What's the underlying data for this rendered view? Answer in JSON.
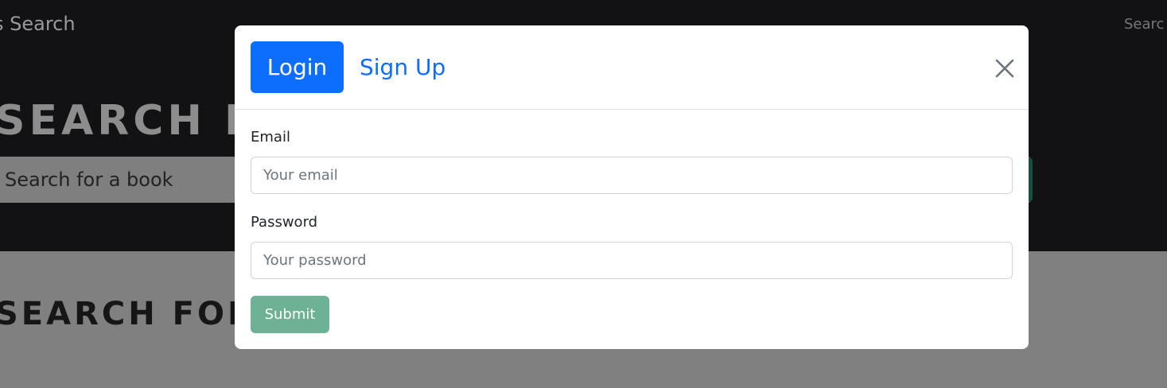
{
  "background": {
    "brand": "s Search",
    "nav_link": "Searc",
    "hero_title": "SEARCH  F",
    "search_placeholder": "Search for a book",
    "section_title": "SEARCH  FOR"
  },
  "modal": {
    "tabs": [
      {
        "label": "Login",
        "active": true
      },
      {
        "label": "Sign Up",
        "active": false
      }
    ],
    "close_icon": "close-icon",
    "email": {
      "label": "Email",
      "placeholder": "Your email",
      "value": ""
    },
    "password": {
      "label": "Password",
      "placeholder": "Your password",
      "value": ""
    },
    "submit_label": "Submit"
  },
  "colors": {
    "primary": "#0d6efd",
    "submit": "#6db294",
    "overlay": "#808080",
    "navbar": "#121214"
  }
}
